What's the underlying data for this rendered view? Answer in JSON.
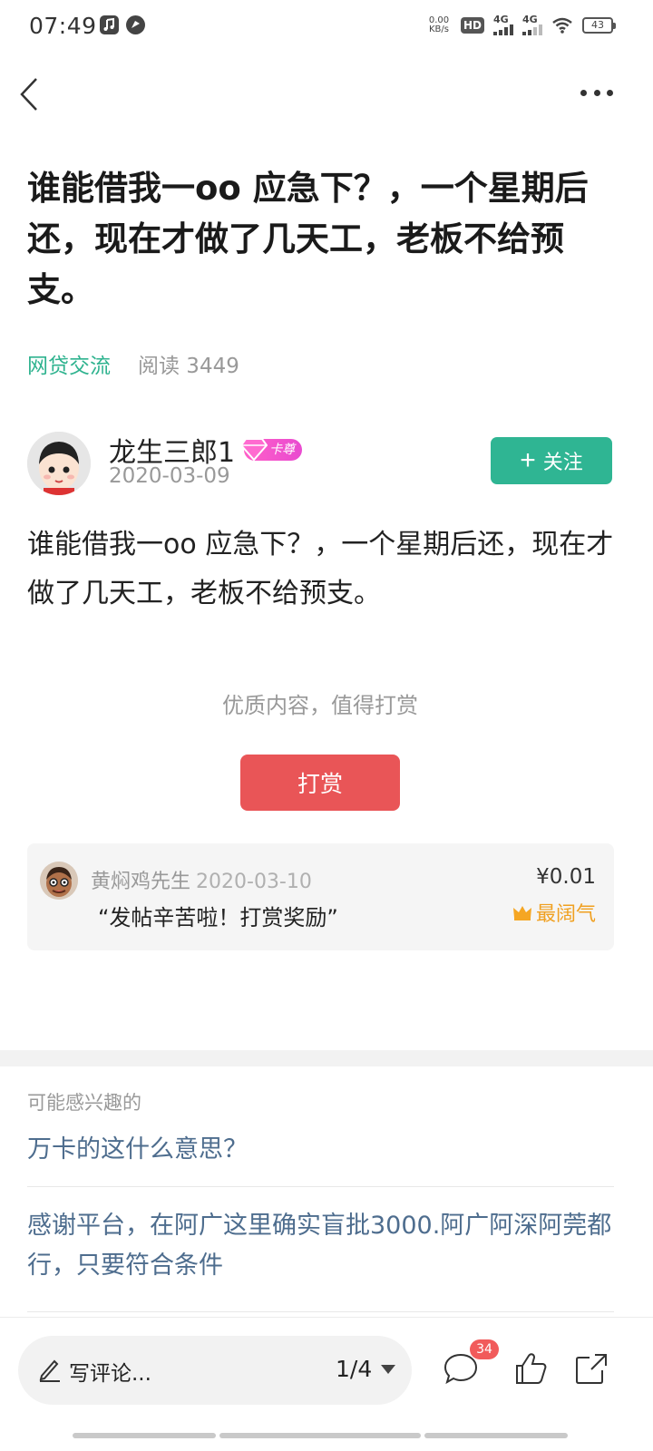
{
  "status_bar": {
    "time": "07:49",
    "net_speed_value": "0.00",
    "net_speed_unit": "KB/s",
    "hd_label": "HD",
    "signal1_label": "4G",
    "signal2_label": "4G",
    "battery": "43"
  },
  "icons": {
    "back": "chevron-left-icon",
    "more": "more-dots-icon",
    "music": "music-note-icon",
    "pin": "location-icon",
    "wifi": "wifi-icon",
    "battery": "battery-icon",
    "pencil": "pencil-icon",
    "comment": "comment-bubble-icon",
    "like": "thumbs-up-icon",
    "share": "share-icon",
    "crown": "crown-icon",
    "diamond": "diamond-icon"
  },
  "post": {
    "title": "谁能借我一oo 应急下？，一个星期后还，现在才做了几天工，老板不给预支。",
    "category": "网贷交流",
    "reads": "阅读 3449",
    "author": {
      "name": "龙生三郎1",
      "badge": "卡尊",
      "date": "2020-03-09"
    },
    "follow_label": "关注",
    "body": "谁能借我一oo 应急下？，一个星期后还，现在才做了几天工，老板不给预支。"
  },
  "reward": {
    "hint": "优质内容，值得打赏",
    "button_label": "打赏",
    "record": {
      "name": "黄焖鸡先生",
      "date": "2020-03-10",
      "message": "“发帖辛苦啦！打赏奖励”",
      "amount": "¥0.01",
      "tag": "最阔气"
    }
  },
  "recommend": {
    "label": "可能感兴趣的",
    "items": [
      "万卡的这什么意思？",
      "感谢平台，在阿广这里确实盲批3000.阿广阿深阿莞都行，只要符合条件"
    ]
  },
  "bottom_bar": {
    "comment_placeholder": "写评论...",
    "page_indicator": "1/4",
    "comment_count": "34"
  },
  "colors": {
    "accent_green": "#2fb593",
    "reward_red": "#e95557",
    "link_blue": "#4e6d8e",
    "badge_red": "#f15b5b",
    "crown_gold": "#f0a020"
  }
}
